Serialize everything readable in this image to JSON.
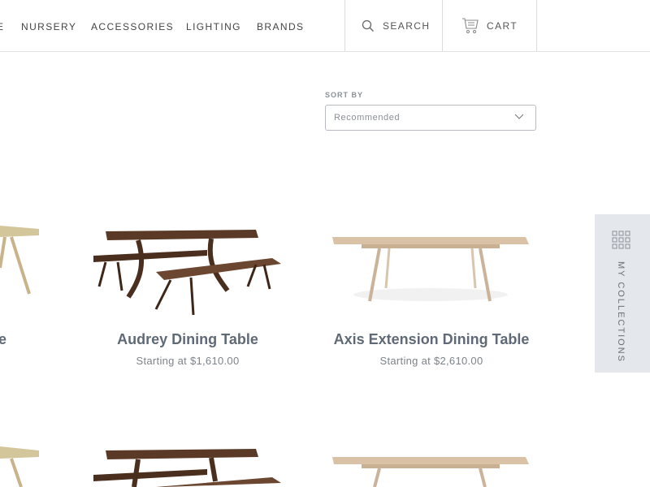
{
  "nav": {
    "items": [
      "E",
      "NURSERY",
      "ACCESSORIES",
      "LIGHTING",
      "BRANDS"
    ],
    "search": "SEARCH",
    "cart": "CART"
  },
  "sort": {
    "label": "SORT BY",
    "value": "Recommended"
  },
  "products": [
    {
      "title": "e",
      "price": ""
    },
    {
      "title": "Audrey Dining Table",
      "price": "Starting at $1,610.00"
    },
    {
      "title": "Axis Extension Dining Table",
      "price": "Starting at $2,610.00"
    }
  ],
  "collections": {
    "label": "MY COLLECTIONS",
    "icon": "grid-icon"
  },
  "colors": {
    "walnut": "#5a3a26",
    "maple": "#d9c2a6",
    "sidebar": "#e4e7eb",
    "title": "#5f6a76"
  }
}
